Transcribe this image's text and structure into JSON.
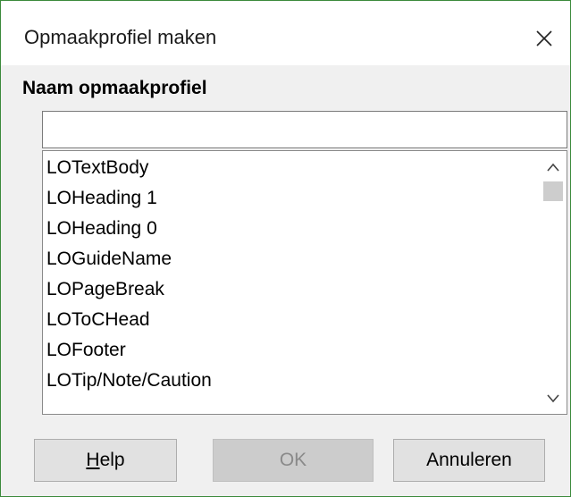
{
  "window": {
    "title": "Opmaakprofiel maken"
  },
  "form": {
    "heading": "Naam opmaakprofiel",
    "name_value": ""
  },
  "styles_list": [
    "LOTextBody",
    "LOHeading 1",
    "LOHeading 0",
    "LOGuideName",
    "LOPageBreak",
    "LOToCHead",
    "LOFooter",
    "LOTip/Note/Caution"
  ],
  "buttons": {
    "help_mnemonic": "H",
    "help_rest": "elp",
    "ok": "OK",
    "cancel": "Annuleren"
  },
  "colors": {
    "window_border": "#3b8a3b",
    "dialog_bg": "#f0f0f0",
    "disabled_text": "#8a8a8a"
  },
  "icons": {
    "close": "close-icon",
    "scroll_up": "chevron-up-icon",
    "scroll_down": "chevron-down-icon"
  }
}
